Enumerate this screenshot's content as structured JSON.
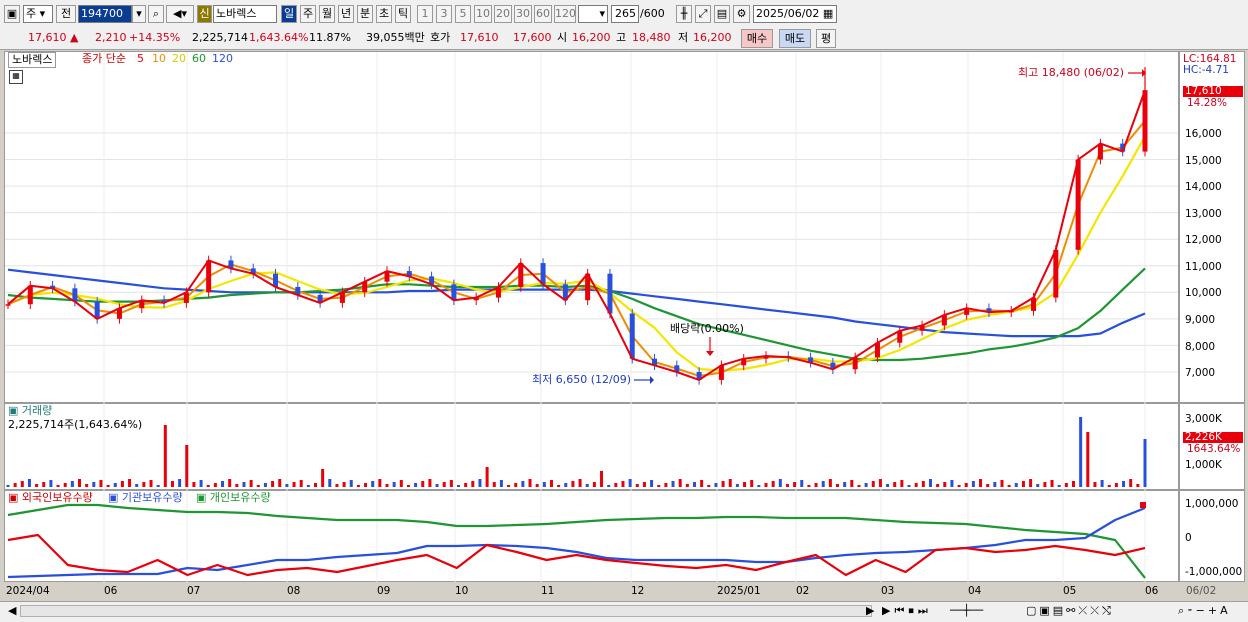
{
  "toolbar": {
    "market": "주",
    "compare": "전",
    "code": "194700",
    "badge": "신",
    "name": "노바렉스",
    "periods": [
      "일",
      "주",
      "월",
      "년",
      "분",
      "초",
      "틱"
    ],
    "active_period": "일",
    "intervals": [
      "1",
      "3",
      "5",
      "10",
      "20",
      "30",
      "60",
      "120"
    ],
    "count": "265",
    "count_total": "/600",
    "date": "2025/06/02"
  },
  "quote": {
    "price": "17,610",
    "change": "2,210",
    "change_pct": "+14.35%",
    "volume": "2,225,714",
    "volume_pct": "1,643.64%",
    "turnover": "11.87%",
    "amount": "39,055백만",
    "bid_label": "호가",
    "bid1": "17,610",
    "bid2": "17,600",
    "open_label": "시",
    "open": "16,200",
    "high_label": "고",
    "high": "18,480",
    "low_label": "저",
    "low": "16,200",
    "buy_label": "매수",
    "sell_label": "매도",
    "eval_label": "평"
  },
  "price_panel": {
    "stock": "노바렉스",
    "legend_prefix": "종가 단순",
    "ma_periods": [
      "5",
      "10",
      "20",
      "60",
      "120"
    ],
    "ma_colors": [
      "#e8000b",
      "#f08c00",
      "#f5e600",
      "#1e9632",
      "#2850dc"
    ],
    "high_note": "최고 18,480 (06/02)",
    "low_note": "최저 6,650 (12/09)",
    "dividend_note": "배당락(0.00%)",
    "lc": "LC:164.81",
    "hc": "HC:-4.71",
    "cur_price_tag": "17,610",
    "cur_pct_tag": "14.28%",
    "y_ticks": [
      "16,000",
      "15,000",
      "14,000",
      "13,000",
      "12,000",
      "11,000",
      "10,000",
      "9,000",
      "8,000",
      "7,000"
    ]
  },
  "volume_panel": {
    "title": "거래량",
    "info": "2,225,714주(1,643.64%)",
    "y_ticks": [
      "3,000K",
      "1,000K"
    ],
    "cur_tag": "2,226K",
    "cur_pct": "1643.64%"
  },
  "holdings_panel": {
    "labels": [
      "외국인보유수량",
      "기관보유수량",
      "개인보유수량"
    ],
    "colors": [
      "#e8000b",
      "#2850dc",
      "#1e9632"
    ],
    "y_ticks": [
      "1,000,000",
      "0",
      "-1,000,000"
    ]
  },
  "x_axis": [
    "2024/04",
    "06",
    "07",
    "08",
    "09",
    "10",
    "11",
    "12",
    "2025/01",
    "02",
    "03",
    "04",
    "05",
    "06",
    "06/02"
  ],
  "chart_data": {
    "type": "line",
    "series": [
      {
        "name": "종가",
        "values": [
          9550,
          10250,
          10150,
          9650,
          9000,
          9400,
          9700,
          9600,
          10000,
          11200,
          10900,
          10700,
          10200,
          9900,
          9600,
          10000,
          10400,
          10800,
          10600,
          10300,
          9700,
          9800,
          10200,
          11100,
          10300,
          9700,
          10700,
          9200,
          7500,
          7250,
          7000,
          6700,
          7250,
          7500,
          7600,
          7550,
          7350,
          7100,
          7550,
          8100,
          8550,
          8750,
          9150,
          9400,
          9250,
          9300,
          9800,
          11600,
          15000,
          15600,
          15300,
          17610
        ]
      },
      {
        "name": "120",
        "values": [
          10850,
          10750,
          10650,
          10550,
          10450,
          10350,
          10250,
          10150,
          10100,
          10050,
          10000,
          10000,
          10000,
          10000,
          10000,
          10000,
          10000,
          10000,
          10050,
          10050,
          10100,
          10100,
          10100,
          10100,
          10100,
          10100,
          10100,
          10050,
          9950,
          9850,
          9750,
          9650,
          9550,
          9450,
          9350,
          9250,
          9150,
          9050,
          8900,
          8800,
          8700,
          8600,
          8500,
          8450,
          8400,
          8350,
          8350,
          8350,
          8350,
          8450,
          8850,
          9200
        ]
      },
      {
        "name": "60",
        "values": [
          9900,
          9800,
          9750,
          9700,
          9650,
          9650,
          9650,
          9700,
          9750,
          9800,
          9900,
          9950,
          10000,
          10000,
          10050,
          10100,
          10200,
          10300,
          10300,
          10250,
          10200,
          10200,
          10200,
          10250,
          10250,
          10200,
          10250,
          10050,
          9750,
          9400,
          9100,
          8800,
          8600,
          8400,
          8200,
          8000,
          7800,
          7650,
          7500,
          7450,
          7450,
          7500,
          7600,
          7700,
          7850,
          7950,
          8100,
          8300,
          8650,
          9300,
          10100,
          10900
        ]
      }
    ],
    "y_range": [
      6400,
      18700
    ]
  }
}
